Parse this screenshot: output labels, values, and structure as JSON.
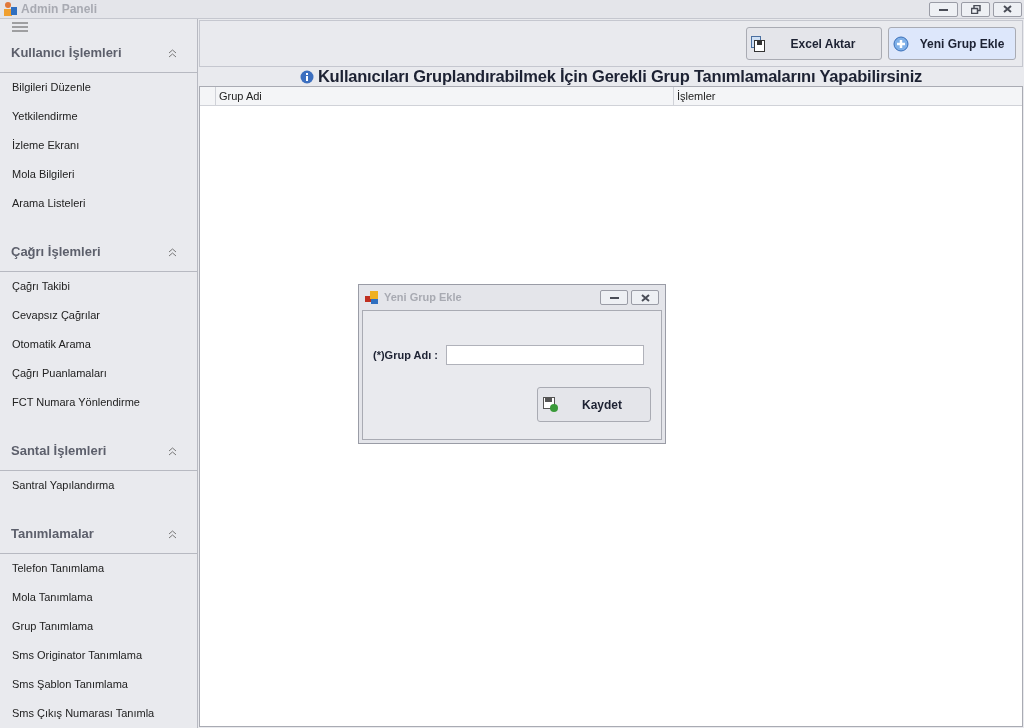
{
  "window": {
    "title": "Admin Paneli"
  },
  "sidebar": {
    "sections": [
      {
        "title": "Kullanıcı İşlemleri",
        "expanded": true,
        "items": [
          "Bilgileri Düzenle",
          "Yetkilendirme",
          "İzleme Ekranı",
          "Mola Bilgileri",
          "Arama Listeleri"
        ]
      },
      {
        "title": "Çağrı İşlemleri",
        "expanded": true,
        "items": [
          "Çağrı Takibi",
          "Cevapsız Çağrılar",
          "Otomatik Arama",
          "Çağrı Puanlamaları",
          "FCT Numara Yönlendirme"
        ]
      },
      {
        "title": "Santal İşlemleri",
        "expanded": true,
        "items": [
          "Santral Yapılandırma"
        ]
      },
      {
        "title": "Tanımlamalar",
        "expanded": true,
        "items": [
          "Telefon Tanımlama",
          "Mola Tanımlama",
          "Grup Tanımlama",
          "Sms Originator Tanımlama",
          "Sms Şablon Tanımlama",
          "Sms Çıkış Numarası Tanımla"
        ]
      }
    ]
  },
  "toolbar": {
    "buttons": [
      {
        "label": "Excel Aktar",
        "kind": "export",
        "selected": false
      },
      {
        "label": "Yeni Grup Ekle",
        "kind": "add",
        "selected": true
      }
    ]
  },
  "heading": "Kullanıcıları Gruplandırabilmek İçin Gerekli Grup Tanımlamalarını Yapabilirsiniz",
  "table": {
    "columns": [
      "Grup Adi",
      "İşlemler"
    ]
  },
  "dialog": {
    "title": "Yeni Grup Ekle",
    "field_label": "(*)Grup Adı :",
    "button": "Kaydet"
  }
}
